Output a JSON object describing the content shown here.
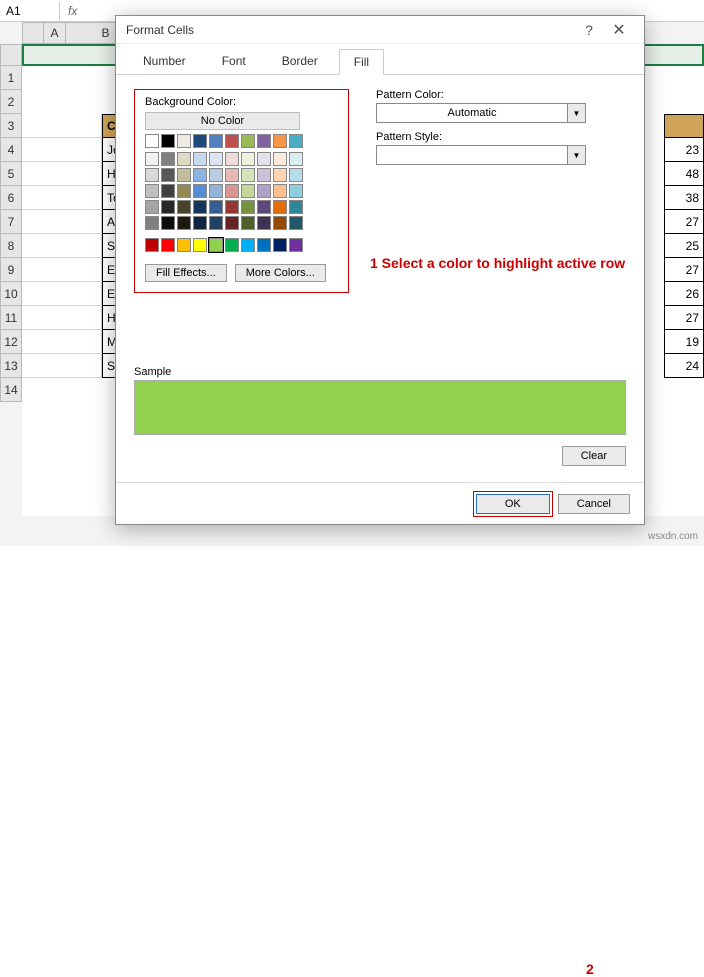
{
  "formula_bar": {
    "cell_ref": "A1",
    "fx": "fx"
  },
  "columns": [
    "A",
    "B"
  ],
  "rows_visible": [
    "1",
    "2",
    "3",
    "4",
    "5",
    "6",
    "7",
    "8",
    "9",
    "10",
    "11",
    "12",
    "13",
    "14"
  ],
  "table": {
    "header": "Customer",
    "names": [
      "Jonathan",
      "Harold Fi",
      "Tom Clen",
      "Ana Hath",
      "Stuart Gil",
      "Eden Stev",
      "Ema Bulg",
      "Harry Hof",
      "Macancy",
      "Simson G"
    ],
    "right_nums": [
      "23",
      "48",
      "38",
      "27",
      "25",
      "27",
      "26",
      "27",
      "19",
      "24"
    ]
  },
  "dialog": {
    "title": "Format Cells",
    "help": "?",
    "close": "✕",
    "tabs": {
      "number": "Number",
      "font": "Font",
      "border": "Border",
      "fill": "Fill"
    },
    "bg_label": "Background Color:",
    "no_color": "No Color",
    "fill_effects": "Fill Effects...",
    "more_colors": "More Colors...",
    "pattern_color_label": "Pattern Color:",
    "pattern_color_value": "Automatic",
    "pattern_style_label": "Pattern Style:",
    "pattern_style_value": "",
    "sample_label": "Sample",
    "clear": "Clear",
    "ok": "OK",
    "cancel": "Cancel"
  },
  "annotations": {
    "step1": "1 Select a color to highlight active row",
    "step2": "2"
  },
  "watermark": "wsxdn.com"
}
